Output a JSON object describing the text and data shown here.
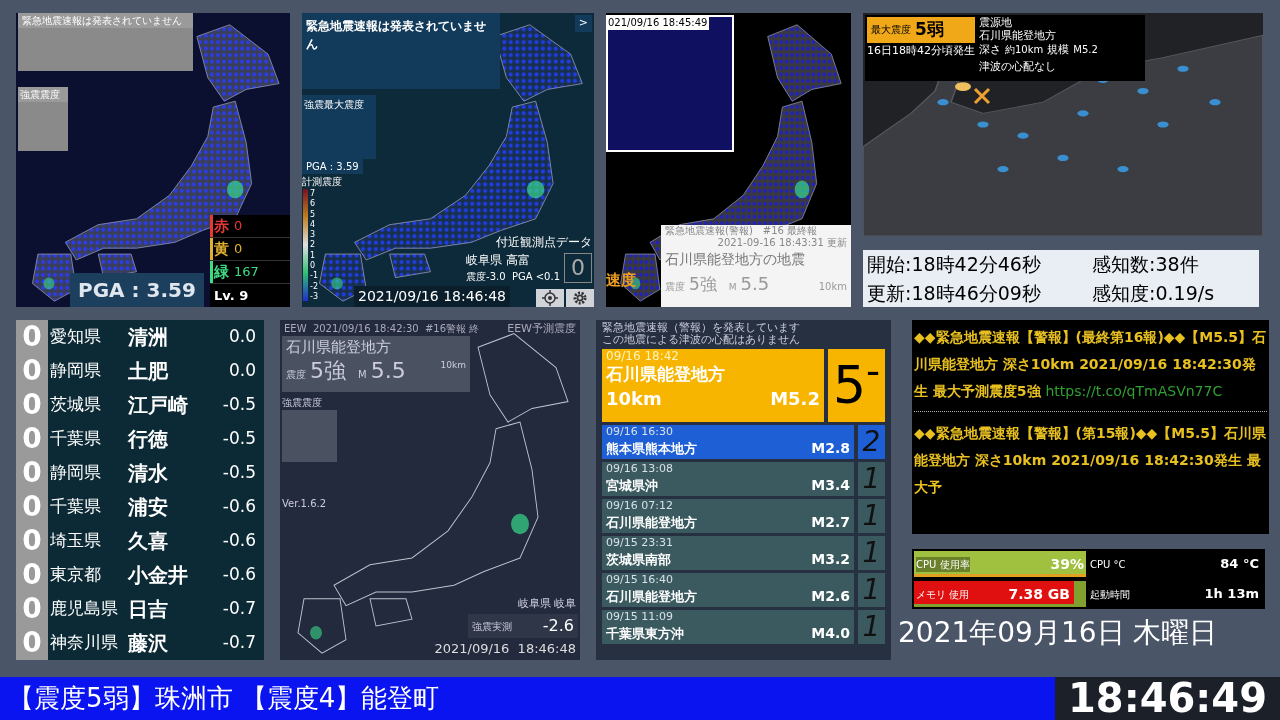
{
  "kyoshin_monitor": {
    "banner": "緊急地震速報は発表されていません",
    "inset_label": "強震震度",
    "pga": "PGA : 3.59",
    "level_text": "Lv. 9",
    "counts": [
      {
        "label": "赤",
        "value": "0",
        "color": "#e53935"
      },
      {
        "label": "黄",
        "value": "0",
        "color": "#e0b030"
      },
      {
        "label": "緑",
        "value": "167",
        "color": "#3ddc84"
      }
    ]
  },
  "realtime_map": {
    "banner": "緊急地震速報は発表されていません",
    "expand": ">",
    "inset_label": "強震最大震度",
    "pga": "PGA : 3.59",
    "scale_title": "計測震度",
    "scale_ticks": [
      "7",
      "6",
      "5",
      "4",
      "3",
      "2",
      "1",
      "0",
      "-1",
      "-2",
      "-3"
    ],
    "nearby_title": "付近観測点データ",
    "station": "岐阜県 高富",
    "station_detail": "震度-3.0  PGA <0.1",
    "station_value": "0",
    "timestamp": "2021/09/16 18:46:48"
  },
  "eew_map": {
    "timestamp": "021/09/16 18:45:49",
    "side_label": "速度",
    "header": "緊急地震速報(警報)　#16 最終報",
    "updated": "2021-09-16 18:43:31 更新",
    "title": "石川県能登地方の地震",
    "intensity_label": "震度",
    "intensity": "5強",
    "mag_prefix": "M",
    "magnitude": "5.5",
    "depth": "10km"
  },
  "intensity_map": {
    "badge_label": "最大震度",
    "badge_value": "5弱",
    "occurred": "16日18時42分頃発生",
    "epicenter_label": "震源地",
    "epicenter": "石川県能登地方",
    "depth_label": "深さ",
    "depth": "約10km",
    "mag_label": "規模",
    "magnitude": "M5.2",
    "tsunami": "津波の心配なし"
  },
  "detection": [
    "開始:18時42分46秒",
    "感知数:38件",
    "更新:18時46分09秒",
    "感知度:0.19/s"
  ],
  "station_ranking": [
    {
      "shindo": "0",
      "prefecture": "愛知県",
      "city": "清洲",
      "value": "0.0"
    },
    {
      "shindo": "0",
      "prefecture": "静岡県",
      "city": "土肥",
      "value": "0.0"
    },
    {
      "shindo": "0",
      "prefecture": "茨城県",
      "city": "江戸崎",
      "value": "-0.5"
    },
    {
      "shindo": "0",
      "prefecture": "千葉県",
      "city": "行徳",
      "value": "-0.5"
    },
    {
      "shindo": "0",
      "prefecture": "静岡県",
      "city": "清水",
      "value": "-0.5"
    },
    {
      "shindo": "0",
      "prefecture": "千葉県",
      "city": "浦安",
      "value": "-0.6"
    },
    {
      "shindo": "0",
      "prefecture": "埼玉県",
      "city": "久喜",
      "value": "-0.6"
    },
    {
      "shindo": "0",
      "prefecture": "東京都",
      "city": "小金井",
      "value": "-0.6"
    },
    {
      "shindo": "0",
      "prefecture": "鹿児島県",
      "city": "日吉",
      "value": "-0.7"
    },
    {
      "shindo": "0",
      "prefecture": "神奈川県",
      "city": "藤沢",
      "value": "-0.7"
    }
  ],
  "eew_forecast": {
    "header": "EEW  2021/09/16 18:42:30  #16警報 終",
    "title_right": "EEW予測震度",
    "area": "石川県能登地方",
    "intensity_label": "震度",
    "intensity": "5強",
    "mag_prefix": "M",
    "magnitude": "5.5",
    "depth": "10km",
    "inset_label": "強震震度",
    "version": "Ver.1.6.2",
    "station": "岐阜県 岐阜",
    "measure_label": "強震実測",
    "measure": "-2.6",
    "timestamp": "2021/09/16  18:46:48"
  },
  "quake_history": {
    "notice": [
      "緊急地震速報（警報）を発表しています",
      "この地震による津波の心配はありません"
    ],
    "current": {
      "time": "09/16  18:42",
      "area": "石川県能登地方",
      "depth": "10km",
      "magnitude": "M5.2",
      "intensity": "5$^{-}$"
    },
    "items": [
      {
        "time": "09/16  16:30",
        "area": "熊本県熊本地方",
        "magnitude": "M2.8",
        "intensity": "2",
        "color": "#1f5fd6"
      },
      {
        "time": "09/16  13:08",
        "area": "宮城県沖",
        "magnitude": "M3.4",
        "intensity": "1",
        "color": "#3a5a60"
      },
      {
        "time": "09/16  07:12",
        "area": "石川県能登地方",
        "magnitude": "M2.7",
        "intensity": "1",
        "color": "#3a5a60"
      },
      {
        "time": "09/15  23:31",
        "area": "茨城県南部",
        "magnitude": "M3.2",
        "intensity": "1",
        "color": "#3a5a60"
      },
      {
        "time": "09/15  16:40",
        "area": "石川県能登地方",
        "magnitude": "M2.6",
        "intensity": "1",
        "color": "#3a5a60"
      },
      {
        "time": "09/15  11:09",
        "area": "千葉県東方沖",
        "magnitude": "M4.0",
        "intensity": "1",
        "color": "#3a5a60"
      }
    ]
  },
  "tweets": [
    {
      "text": "◆◆緊急地震速報【警報】(最終第16報)◆◆【M5.5】石川県能登地方 深さ10km 2021/09/16 18:42:30発生 最大予測震度5強",
      "link": "https://t.co/qTmASVn77C"
    },
    {
      "text": "◆◆緊急地震速報【警報】(第15報)◆◆【M5.5】石川県能登地方 深さ10km 2021/09/16 18:42:30発生 最大予"
    }
  ],
  "system_monitor": {
    "cpu_label": "CPU 使用率",
    "cpu_value": "39%",
    "memory_label": "メモリ 使用",
    "memory_value": "7.38 GB",
    "memory": {
      "level": 0.93
    },
    "temp_label": "CPU °C",
    "temp_value": "84 °C",
    "uptime_label": "起動時間",
    "uptime_value": "1h 13m"
  },
  "date": "2021年09月16日 木曜日",
  "ticker": "【震度5弱】珠洲市 【震度4】能登町",
  "clock": "18:46:49"
}
